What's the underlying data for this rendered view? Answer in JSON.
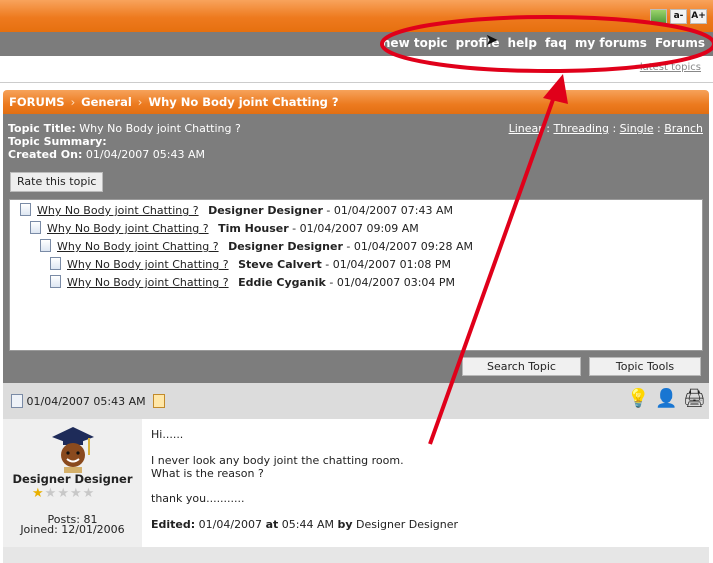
{
  "font_tools": {
    "decrease": "a-",
    "increase": "A+"
  },
  "nav": [
    "new topic",
    "profile",
    "help",
    "faq",
    "my forums",
    "Forums"
  ],
  "latest_topics_link": "latest topics",
  "breadcrumb": {
    "forums": "FORUMS",
    "general": "General",
    "topic": "Why No Body joint Chatting ?",
    "sep": "›"
  },
  "topic_info": {
    "title_label": "Topic Title:",
    "title_value": "Why No Body joint Chatting ?",
    "summary_label": "Topic Summary:",
    "created_label": "Created On:",
    "created_value": "01/04/2007 05:43 AM"
  },
  "view_modes": [
    "Linear",
    "Threading",
    "Single",
    "Branch"
  ],
  "rate_button": "Rate this topic",
  "thread": [
    {
      "title": "Why No Body joint Chatting ?",
      "author": "Designer Designer",
      "date": "01/04/2007 07:43 AM"
    },
    {
      "title": "Why No Body joint Chatting ?",
      "author": "Tim Houser",
      "date": "01/04/2007 09:09 AM"
    },
    {
      "title": "Why No Body joint Chatting ?",
      "author": "Designer Designer",
      "date": "01/04/2007 09:28 AM"
    },
    {
      "title": "Why No Body joint Chatting ?",
      "author": "Steve Calvert",
      "date": "01/04/2007 01:08 PM"
    },
    {
      "title": "Why No Body joint Chatting ?",
      "author": "Eddie Cyganik",
      "date": "01/04/2007 03:04 PM"
    }
  ],
  "search_topic_button": "Search Topic",
  "topic_tools_button": "Topic Tools",
  "post": {
    "date": "01/04/2007 05:43 AM",
    "author": "Designer Designer",
    "stars": 1,
    "posts": "Posts: 81",
    "joined": "Joined: 12/01/2006",
    "lines": [
      "Hi......",
      "I never look any body joint the chatting room.",
      "What is the reason ?",
      "thank you..........."
    ],
    "edited_label": "Edited:",
    "edited_date": "01/04/2007",
    "edited_at": "at",
    "edited_time": "05:44 AM",
    "edited_by": "by",
    "edited_user": "Designer Designer"
  },
  "colors": {
    "orange": "#ec7a1f",
    "nav_gray": "#7c7c7c",
    "annotation_red": "#e0001a"
  }
}
